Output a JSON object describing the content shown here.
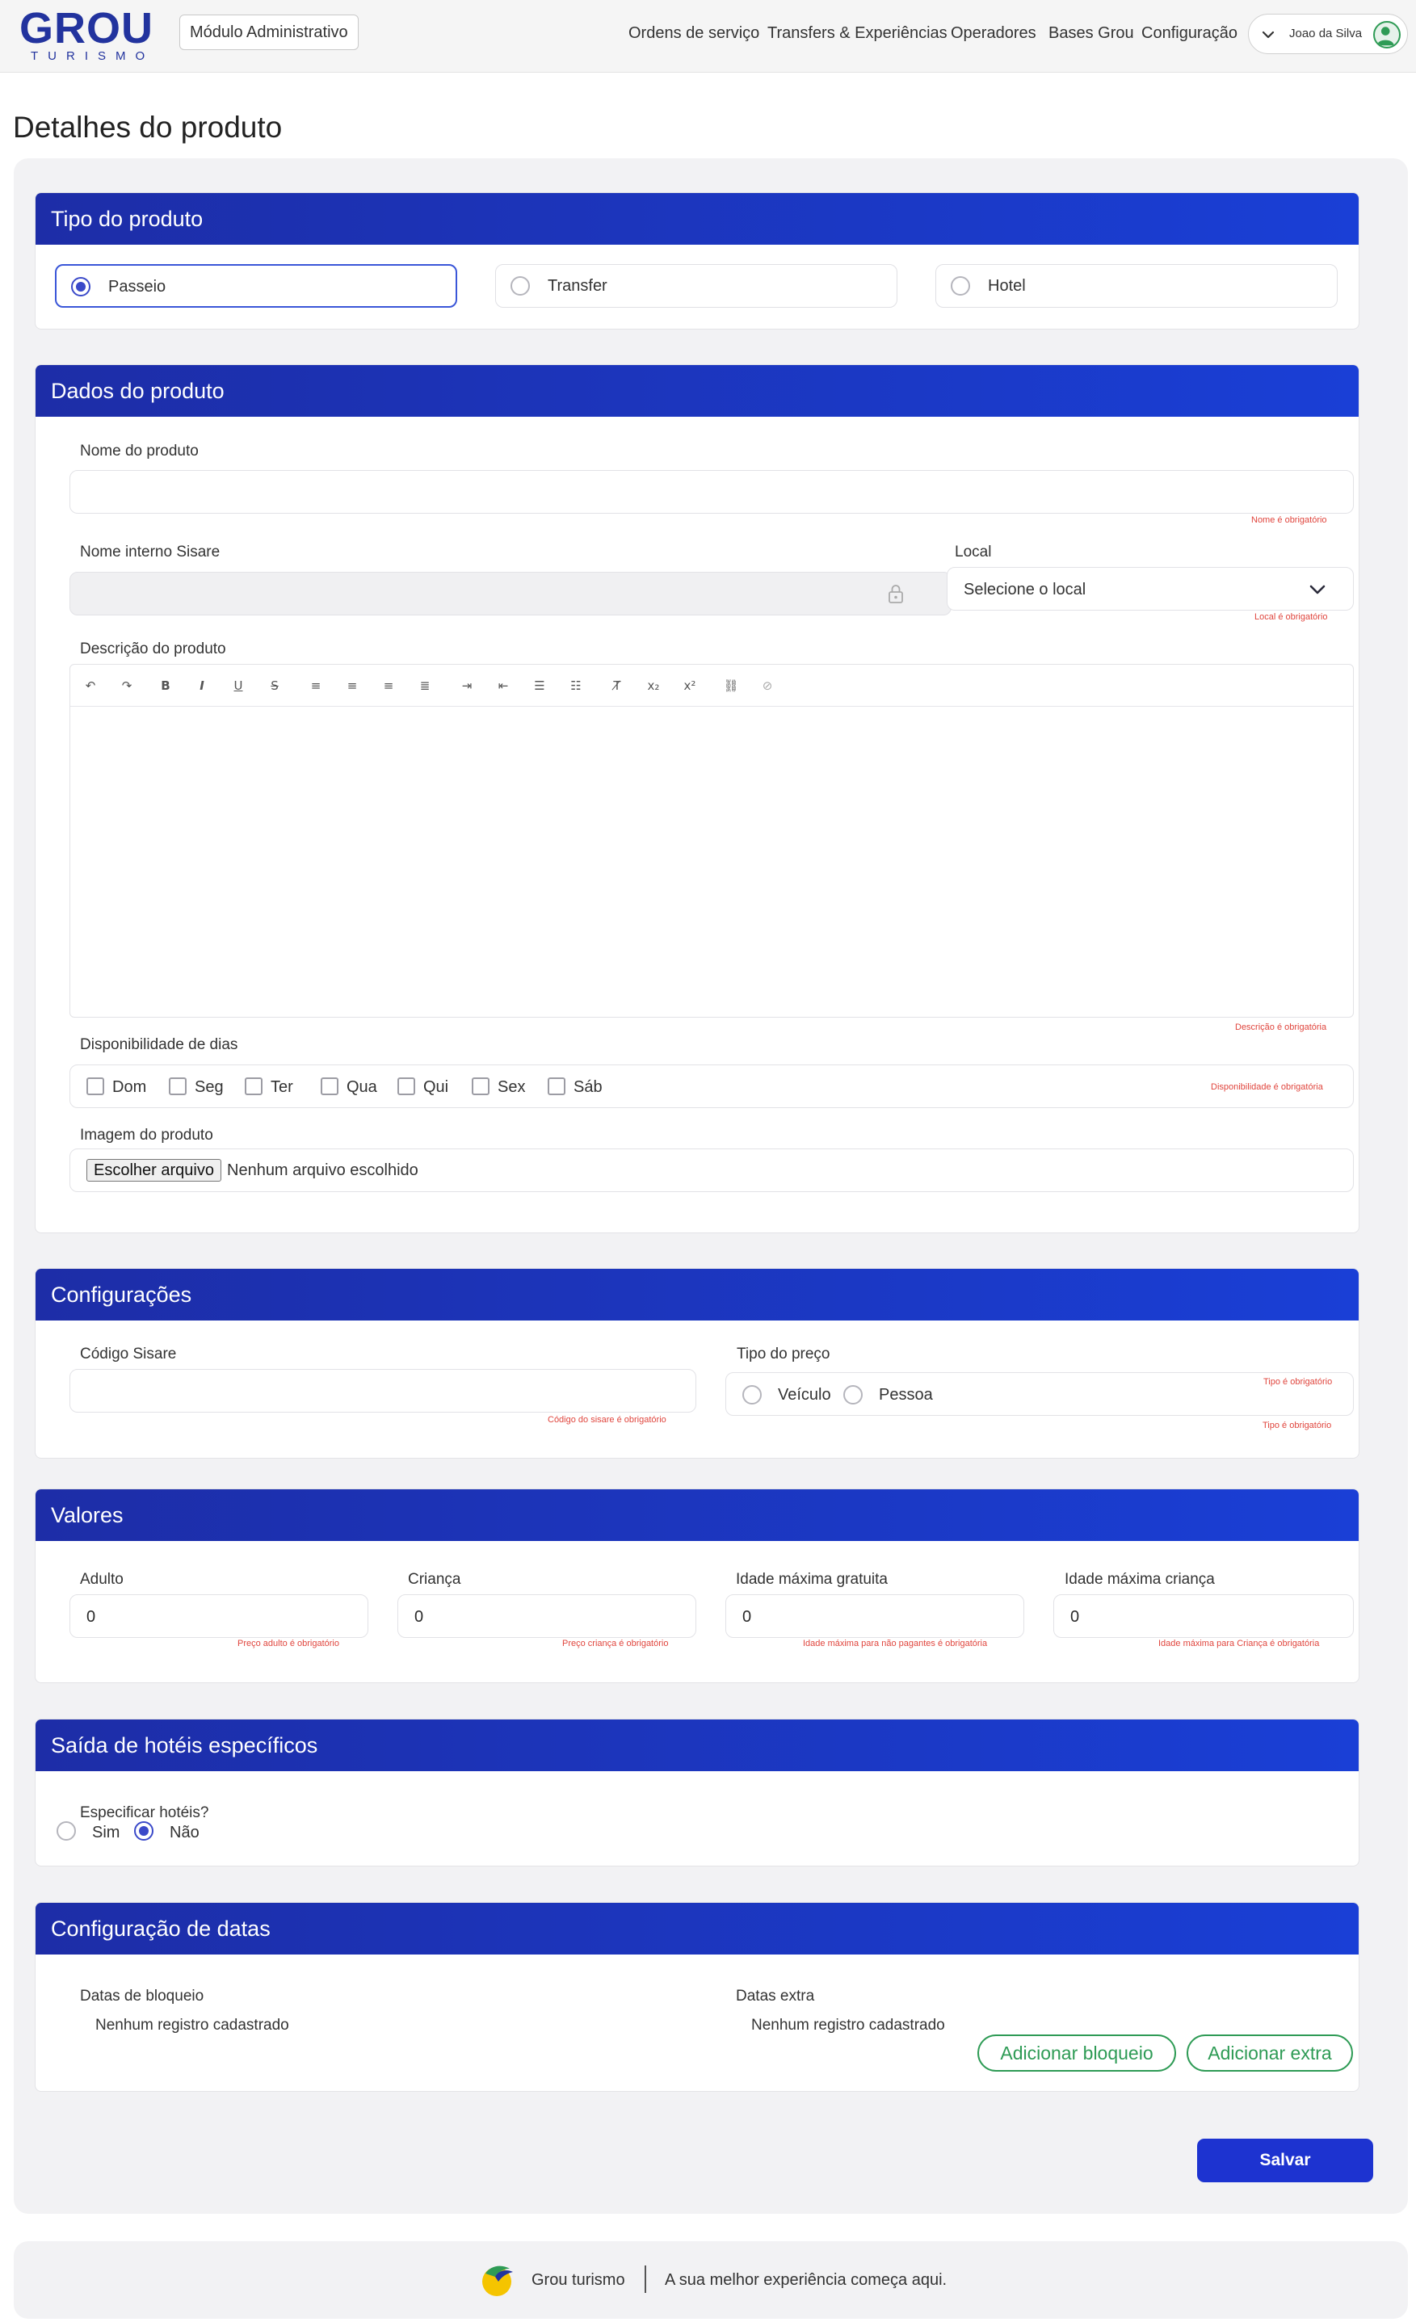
{
  "header": {
    "logo_text": "GROU",
    "logo_subtext": "TURISMO",
    "module_label": "Módulo Administrativo",
    "nav": [
      "Ordens de serviço",
      "Transfers & Experiências",
      "Operadores",
      "Bases Grou",
      "Configuração"
    ],
    "user_name": "Joao da Silva"
  },
  "page": {
    "title": "Detalhes do produto"
  },
  "tipo": {
    "heading": "Tipo do produto",
    "options": [
      "Passeio",
      "Transfer",
      "Hotel"
    ],
    "selected": "Passeio"
  },
  "dados": {
    "heading": "Dados do produto",
    "nome_label": "Nome do produto",
    "nome_value": "",
    "nome_error": "Nome é obrigatório",
    "interno_label": "Nome interno Sisare",
    "interno_value": "",
    "local_label": "Local",
    "local_value": "Selecione o local",
    "local_error": "Local é obrigatório",
    "descricao_label": "Descrição do produto",
    "descricao_error": "Descrição é obrigatória",
    "dias_label": "Disponibilidade de dias",
    "dias": [
      "Dom",
      "Seg",
      "Ter",
      "Qua",
      "Qui",
      "Sex",
      "Sáb"
    ],
    "dias_error": "Disponibilidade é obrigatória",
    "imagem_label": "Imagem do produto",
    "file_button": "Escolher arquivo",
    "file_status": "Nenhum arquivo escolhido"
  },
  "config": {
    "heading": "Configurações",
    "codigo_label": "Código Sisare",
    "codigo_value": "",
    "codigo_error": "Código do sisare é obrigatório",
    "preco_label": "Tipo do preço",
    "preco_options": [
      "Veículo",
      "Pessoa"
    ],
    "preco_error": "Tipo é obrigatório"
  },
  "valores": {
    "heading": "Valores",
    "fields": [
      {
        "label": "Adulto",
        "value": "0",
        "error": "Preço adulto é obrigatório"
      },
      {
        "label": "Criança",
        "value": "0",
        "error": "Preço criança é obrigatório"
      },
      {
        "label": "Idade máxima gratuita",
        "value": "0",
        "error": "Idade máxima para não pagantes é obrigatória"
      },
      {
        "label": "Idade máxima criança",
        "value": "0",
        "error": "Idade máxima para Criança é obrigatória"
      }
    ]
  },
  "hoteis": {
    "heading": "Saída de hotéis específicos",
    "question": "Especificar hotéis?",
    "options": [
      "Sim",
      "Não"
    ],
    "selected": "Não"
  },
  "datas": {
    "heading": "Configuração de datas",
    "bloqueio_label": "Datas de bloqueio",
    "bloqueio_empty": "Nenhum registro cadastrado",
    "extra_label": "Datas extra",
    "extra_empty": "Nenhum registro cadastrado",
    "add_bloqueio": "Adicionar bloqueio",
    "add_extra": "Adicionar extra"
  },
  "save_label": "Salvar",
  "footer": {
    "brand": "Grou turismo",
    "tagline": "A sua melhor experiência começa aqui."
  }
}
